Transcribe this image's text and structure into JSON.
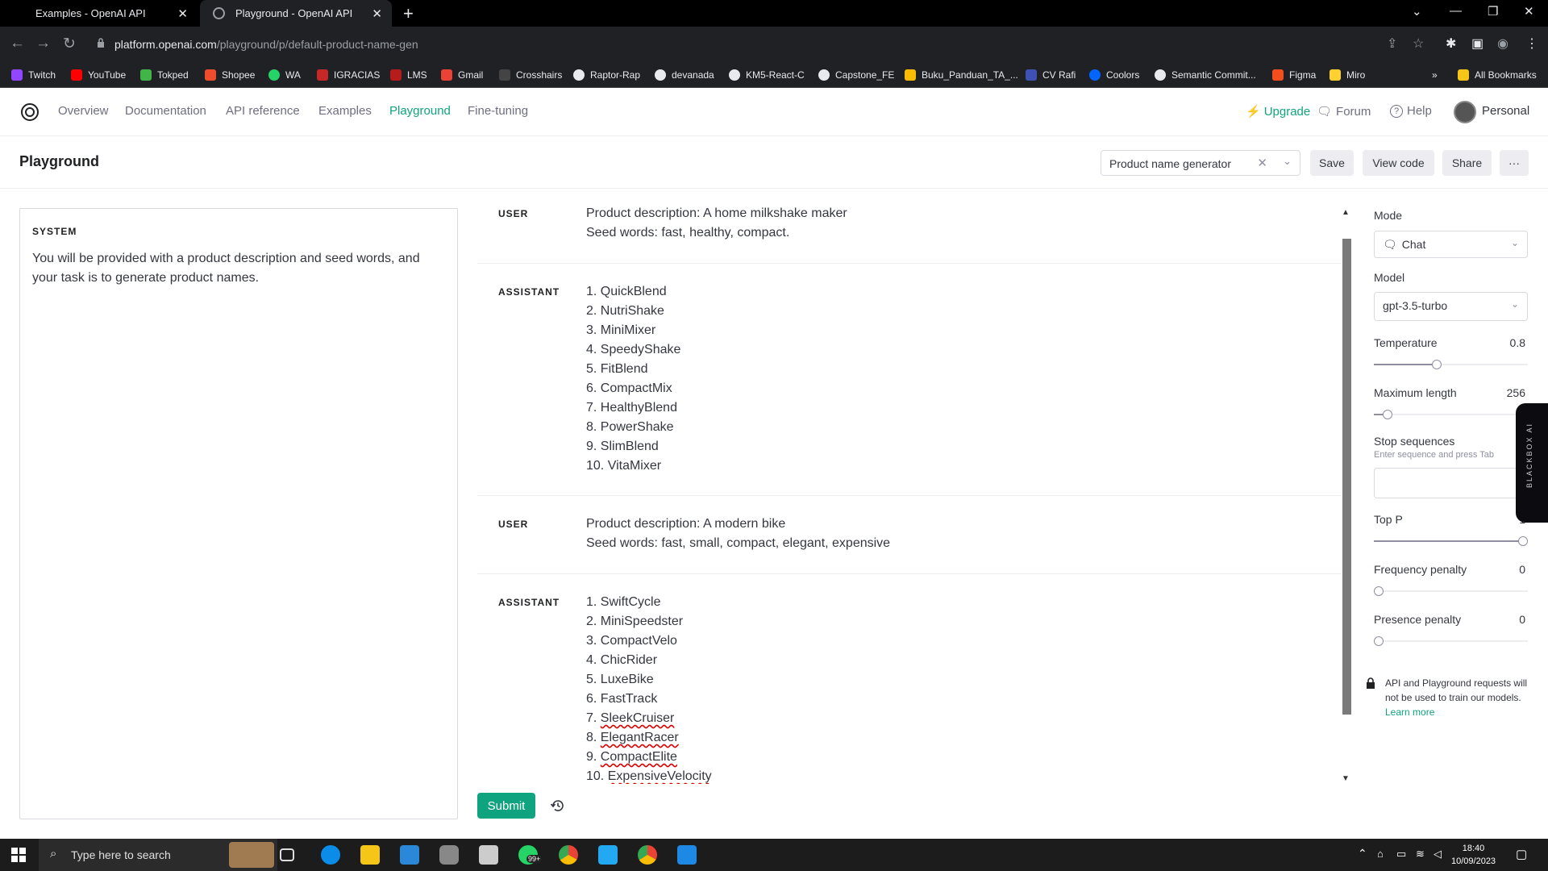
{
  "browser": {
    "tabs": [
      {
        "title": "Examples - OpenAI API"
      },
      {
        "title": "Playground - OpenAI API"
      }
    ],
    "url_host": "platform.openai.com",
    "url_path": "/playground/p/default-product-name-gen",
    "bookmarks": [
      "Twitch",
      "YouTube",
      "Tokped",
      "Shopee",
      "WA",
      "IGRACIAS",
      "LMS",
      "Gmail",
      "Crosshairs",
      "Raptor-Rap",
      "devanada",
      "KM5-React-C",
      "Capstone_FE",
      "Buku_Panduan_TA_...",
      "CV Rafi",
      "Coolors",
      "Semantic Commit...",
      "Figma",
      "Miro"
    ],
    "all_bookmarks": "All Bookmarks"
  },
  "nav": {
    "links": [
      "Overview",
      "Documentation",
      "API reference",
      "Examples",
      "Playground",
      "Fine-tuning"
    ],
    "upgrade": "Upgrade",
    "forum": "Forum",
    "help": "Help",
    "personal": "Personal"
  },
  "page": {
    "title": "Playground",
    "preset": "Product name generator",
    "save": "Save",
    "view_code": "View code",
    "share": "Share",
    "more": "···"
  },
  "system": {
    "label": "SYSTEM",
    "text": "You will be provided with a product description and seed words, and your task is to generate product names."
  },
  "messages": [
    {
      "role": "USER",
      "lines": [
        "Product description: A home milkshake maker",
        "Seed words: fast, healthy, compact."
      ]
    },
    {
      "role": "ASSISTANT",
      "lines": [
        "1. QuickBlend",
        "2. NutriShake",
        "3. MiniMixer",
        "4. SpeedyShake",
        "5. FitBlend",
        "6. CompactMix",
        "7. HealthyBlend",
        "8. PowerShake",
        "9. SlimBlend",
        "10. VitaMixer"
      ]
    },
    {
      "role": "USER",
      "lines": [
        "Product description: A modern bike",
        "Seed words: fast, small, compact, elegant, expensive"
      ]
    },
    {
      "role": "ASSISTANT",
      "lines": [
        "1. SwiftCycle",
        "2. MiniSpeedster",
        "3. CompactVelo",
        "4. ChicRider",
        "5. LuxeBike",
        "6. FastTrack",
        "7. SleekCruiser",
        "8. ElegantRacer",
        "9. CompactElite",
        "10. ExpensiveVelocity"
      ]
    }
  ],
  "submit": "Submit",
  "settings": {
    "mode_label": "Mode",
    "mode_value": "Chat",
    "model_label": "Model",
    "model_value": "gpt-3.5-turbo",
    "temperature_label": "Temperature",
    "temperature_value": "0.8",
    "temperature_fraction": 0.4,
    "max_length_label": "Maximum length",
    "max_length_value": "256",
    "max_length_fraction": 0.06,
    "stop_label": "Stop sequences",
    "stop_hint": "Enter sequence and press Tab",
    "top_p_label": "Top P",
    "top_p_value": "1",
    "top_p_fraction": 1.0,
    "freq_label": "Frequency penalty",
    "freq_value": "0",
    "freq_fraction": 0,
    "pres_label": "Presence penalty",
    "pres_value": "0",
    "pres_fraction": 0,
    "notice": "API and Playground requests will not be used to train our models.",
    "learn_more": "Learn more"
  },
  "extension": {
    "label": "BLACKBOX AI"
  },
  "taskbar": {
    "search_placeholder": "Type here to search",
    "time": "18:40",
    "date": "10/09/2023",
    "badge": "99+"
  },
  "colors": {
    "accent": "#10a37f"
  }
}
